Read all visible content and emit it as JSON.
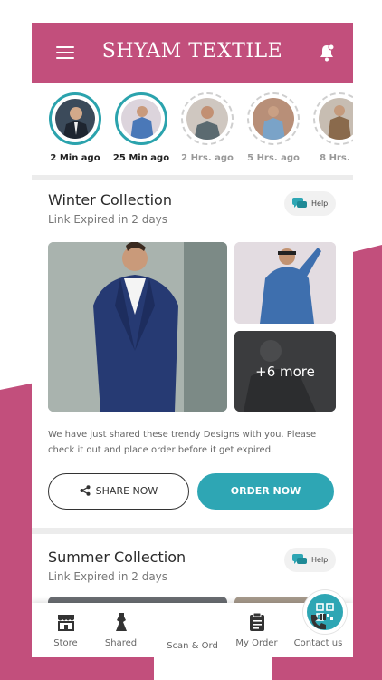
{
  "app": {
    "title": "SHYAM TEXTILE"
  },
  "colors": {
    "brand": "#c24f7c",
    "accent": "#2ea6b4"
  },
  "stories": [
    {
      "time": "2 Min ago",
      "seen": false
    },
    {
      "time": "25 Min ago",
      "seen": false
    },
    {
      "time": "2 Hrs. ago",
      "seen": true
    },
    {
      "time": "5 Hrs. ago",
      "seen": true
    },
    {
      "time": "8 Hrs. a",
      "seen": true
    }
  ],
  "collections": [
    {
      "title": "Winter Collection",
      "subtitle": "Link Expired in 2 days",
      "help_label": "Help",
      "more_label": "+6 more",
      "description": "We have just shared these trendy Designs with you. Please check it out and place order before it get expired.",
      "share_label": "SHARE NOW",
      "order_label": "ORDER NOW"
    },
    {
      "title": "Summer Collection",
      "subtitle": "Link Expired in 2 days",
      "help_label": "Help"
    }
  ],
  "nav": [
    {
      "label": "Store",
      "icon": "store-icon"
    },
    {
      "label": "Shared",
      "icon": "dress-icon"
    },
    {
      "label": "Scan & Ord",
      "icon": "qr-icon"
    },
    {
      "label": "My Order",
      "icon": "clipboard-icon"
    },
    {
      "label": "Contact us",
      "icon": "phone-icon"
    }
  ]
}
